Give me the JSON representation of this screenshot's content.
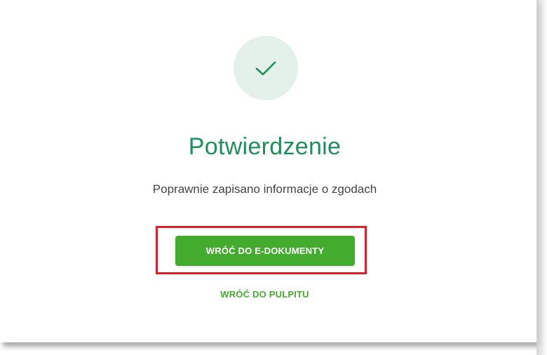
{
  "confirmation": {
    "icon": "check-icon",
    "title": "Potwierdzenie",
    "message": "Poprawnie zapisano informacje o zgodach"
  },
  "actions": {
    "primary_label": "WRÓĆ DO E-DOKUMENTY",
    "secondary_label": "WRÓĆ DO PULPITU"
  },
  "colors": {
    "accent_green": "#1e8f5a",
    "button_green": "#43ac2f",
    "icon_circle_bg": "#e3f1ea",
    "highlight_red": "#d9202b"
  }
}
